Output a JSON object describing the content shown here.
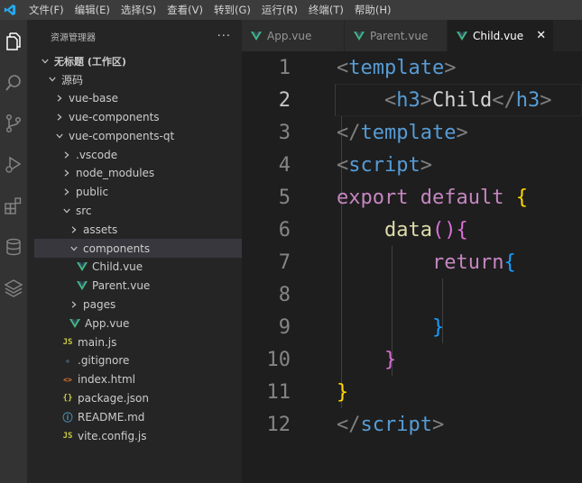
{
  "menu": [
    "文件(F)",
    "编辑(E)",
    "选择(S)",
    "查看(V)",
    "转到(G)",
    "运行(R)",
    "终端(T)",
    "帮助(H)"
  ],
  "sidebar": {
    "title": "资源管理器",
    "more": "···",
    "tree": [
      {
        "label": "无标题 (工作区)",
        "kind": "root"
      },
      {
        "label": "源码",
        "kind": "folder-open"
      },
      {
        "label": "vue-base",
        "kind": "folder"
      },
      {
        "label": "vue-components",
        "kind": "folder"
      },
      {
        "label": "vue-components-qt",
        "kind": "folder-open"
      },
      {
        "label": ".vscode",
        "kind": "folder"
      },
      {
        "label": "node_modules",
        "kind": "folder"
      },
      {
        "label": "public",
        "kind": "folder"
      },
      {
        "label": "src",
        "kind": "folder-open"
      },
      {
        "label": "assets",
        "kind": "folder"
      },
      {
        "label": "components",
        "kind": "folder-open"
      },
      {
        "label": "Child.vue",
        "kind": "vue"
      },
      {
        "label": "Parent.vue",
        "kind": "vue"
      },
      {
        "label": "pages",
        "kind": "folder"
      },
      {
        "label": "App.vue",
        "kind": "vue"
      },
      {
        "label": "main.js",
        "kind": "js"
      },
      {
        "label": ".gitignore",
        "kind": "git"
      },
      {
        "label": "index.html",
        "kind": "html"
      },
      {
        "label": "package.json",
        "kind": "json"
      },
      {
        "label": "README.md",
        "kind": "info"
      },
      {
        "label": "vite.config.js",
        "kind": "js"
      }
    ]
  },
  "tabs": [
    {
      "label": "App.vue",
      "active": false
    },
    {
      "label": "Parent.vue",
      "active": false
    },
    {
      "label": "Child.vue",
      "active": true,
      "close": "✕"
    }
  ],
  "editor": {
    "line_numbers": [
      "1",
      "2",
      "3",
      "4",
      "5",
      "6",
      "7",
      "8",
      "9",
      "10",
      "11",
      "12"
    ],
    "current_line": "2"
  },
  "colors": {
    "accent": "#007acc",
    "vue_green": "#41b883",
    "js_yellow": "#cbcb41"
  }
}
